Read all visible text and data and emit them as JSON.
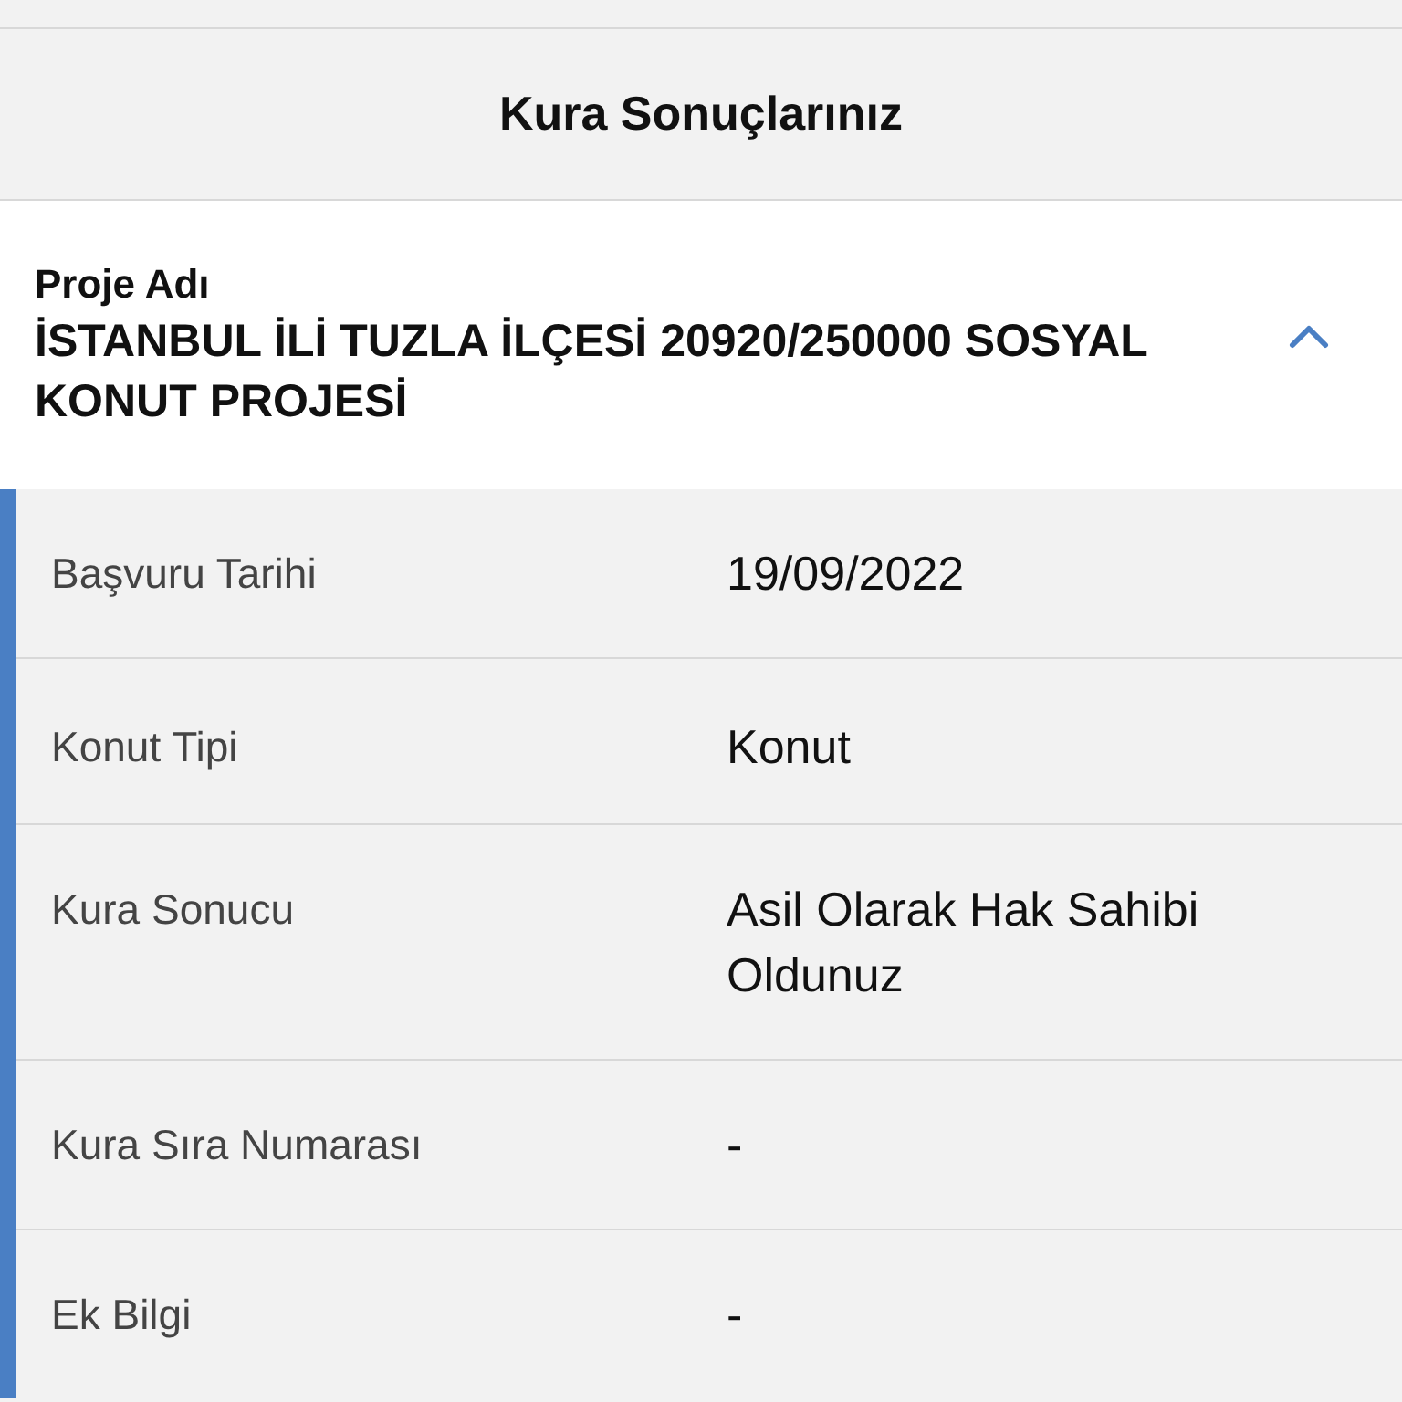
{
  "header": {
    "title": "Kura Sonuçlarınız"
  },
  "project": {
    "label": "Proje Adı",
    "name": "İSTANBUL İLİ TUZLA İLÇESİ 20920/250000 SOSYAL KONUT PROJESİ",
    "expanded": true
  },
  "details": [
    {
      "label": "Başvuru Tarihi",
      "value": "19/09/2022"
    },
    {
      "label": "Konut Tipi",
      "value": "Konut"
    },
    {
      "label": "Kura Sonucu",
      "value": "Asil Olarak Hak Sahibi Oldunuz"
    },
    {
      "label": "Kura Sıra Numarası",
      "value": "-"
    },
    {
      "label": "Ek Bilgi",
      "value": "-"
    }
  ]
}
